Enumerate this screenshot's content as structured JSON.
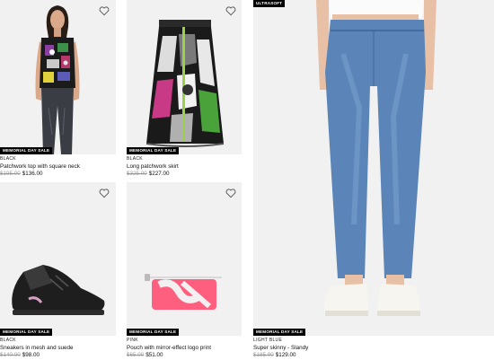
{
  "products": [
    {
      "badge": "MEMORIAL DAY SALE",
      "color": "BLACK",
      "name": "Patchwork top with square neck",
      "old_price": "$195.00",
      "new_price": "$136.00"
    },
    {
      "badge": "MEMORIAL DAY SALE",
      "color": "BLACK",
      "name": "Long patchwork skirt",
      "old_price": "$325.00",
      "new_price": "$227.00"
    },
    {
      "top_badge": "ULTRASOFT",
      "badge": "MEMORIAL DAY SALE",
      "color": "LIGHT BLUE",
      "name": "Super skinny - Slandy",
      "old_price": "$185.00",
      "new_price": "$129.00"
    },
    {
      "badge": "MEMORIAL DAY SALE",
      "color": "BLACK",
      "name": "Sneakers in mesh and suede",
      "old_price": "$140.00",
      "new_price": "$98.00"
    },
    {
      "badge": "MEMORIAL DAY SALE",
      "color": "PINK",
      "name": "Pouch with mirror-effect logo print",
      "old_price": "$65.00",
      "new_price": "$51.00"
    }
  ],
  "icons": {
    "wishlist": "heart-outline-icon"
  },
  "colors": {
    "badge_bg": "#000000",
    "image_bg": "#f1f1f1",
    "strike_price": "#9a9a9a"
  }
}
